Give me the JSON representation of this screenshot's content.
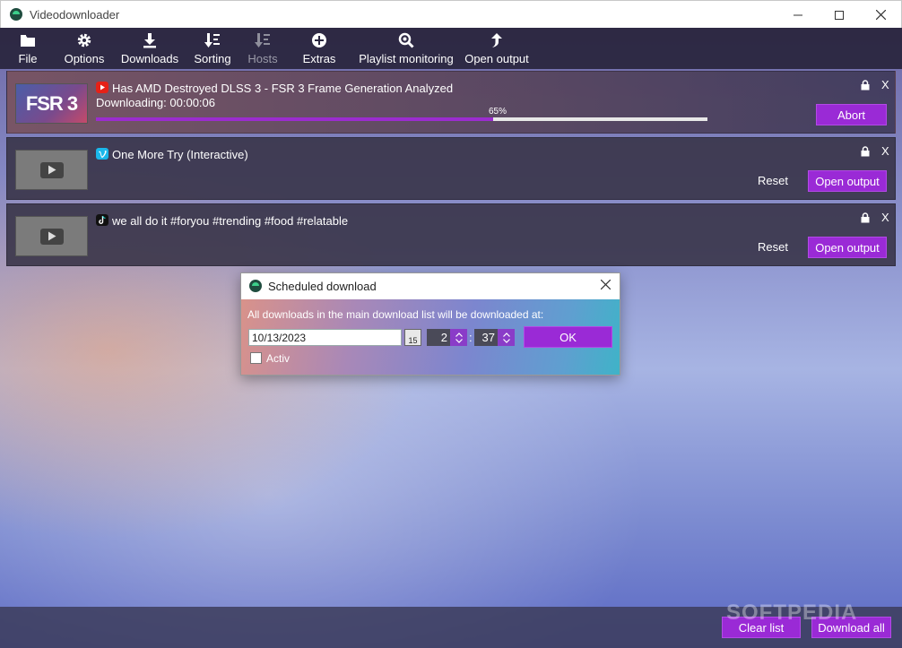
{
  "window": {
    "title": "Videodownloader"
  },
  "toolbar": {
    "items": [
      {
        "label": "File",
        "icon": "folder-icon"
      },
      {
        "label": "Options",
        "icon": "gear-icon"
      },
      {
        "label": "Downloads",
        "icon": "download-icon"
      },
      {
        "label": "Sorting",
        "icon": "sort-icon"
      },
      {
        "label": "Hosts",
        "icon": "hosts-icon"
      },
      {
        "label": "Extras",
        "icon": "plus-circle-icon"
      },
      {
        "label": "Playlist monitoring",
        "icon": "search-icon"
      },
      {
        "label": "Open output",
        "icon": "arrow-up-icon"
      }
    ]
  },
  "downloads": [
    {
      "title": "Has AMD Destroyed DLSS 3 - FSR 3 Frame Generation Analyzed",
      "site": "youtube",
      "thumbnail_text": "FSR 3",
      "status": "Downloading: 00:00:06",
      "progress": 0.65,
      "progress_label": "65%",
      "action": "Abort",
      "close": "X"
    },
    {
      "title": "One More Try (Interactive)",
      "site": "vimeo",
      "reset": "Reset",
      "action": "Open output",
      "close": "X"
    },
    {
      "title": "we all do it #foryou #trending #food #relatable",
      "site": "tiktok",
      "reset": "Reset",
      "action": "Open output",
      "close": "X"
    }
  ],
  "dialog": {
    "title": "Scheduled download",
    "message": "All downloads in the main download list will be downloaded at:",
    "date": "10/13/2023",
    "calendar_day": "15",
    "hour": "2",
    "minute": "37",
    "separator": ":",
    "ok": "OK",
    "checkbox_label": "Activ",
    "checkbox_checked": false
  },
  "footer": {
    "clear": "Clear list",
    "download_all": "Download all",
    "watermark": "SOFTPEDIA"
  },
  "colors": {
    "accent": "#9a2ad6",
    "youtube": "#e62117",
    "vimeo": "#1ab7ea",
    "tiktok": "#111111"
  }
}
